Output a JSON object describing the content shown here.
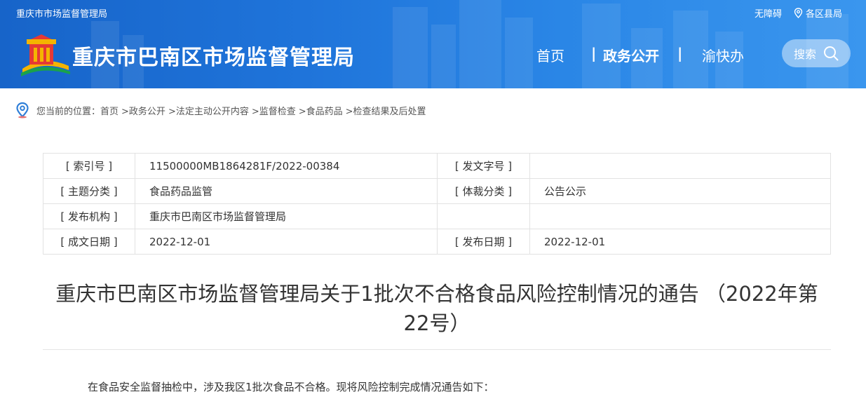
{
  "header": {
    "top_left": "重庆市市场监督管理局",
    "accessibility": "无障碍",
    "districts": "各区县局",
    "site_title": "重庆市巴南区市场监督管理局",
    "nav": {
      "home": "首页",
      "sep": "|",
      "gov": "政务公开",
      "yu": "渝快办"
    },
    "search_label": "搜索"
  },
  "breadcrumb": {
    "prefix": "您当前的位置：",
    "items": [
      "首页",
      ">政务公开",
      ">法定主动公开内容",
      ">监督检查",
      ">食品药品",
      ">检查结果及后处置"
    ]
  },
  "info": {
    "index_label": "[ 索引号 ]",
    "index_value": "11500000MB1864281F/2022-00384",
    "doc_no_label": "[ 发文字号 ]",
    "doc_no_value": "",
    "topic_label": "[ 主题分类 ]",
    "topic_value": "食品药品监管",
    "genre_label": "[ 体裁分类 ]",
    "genre_value": "公告公示",
    "org_label": "[ 发布机构 ]",
    "org_value": "重庆市巴南区市场监督管理局",
    "created_label": "[ 成文日期 ]",
    "created_value": "2022-12-01",
    "published_label": "[ 发布日期 ]",
    "published_value": "2022-12-01"
  },
  "article": {
    "title_line1": "重庆市巴南区市场监督管理局关于1批次不合格食品风险控制情况的通告 （2022年第",
    "title_line2": "22号）",
    "intro": "在食品安全监督抽检中，涉及我区1批次食品不合格。现将风险控制完成情况通告如下："
  },
  "icons": {
    "logo": "party-emblem-logo",
    "location": "location-pin-icon",
    "search": "search-icon"
  },
  "colors": {
    "header_blue": "#1f74da",
    "location_blue": "#2f7fd8"
  }
}
